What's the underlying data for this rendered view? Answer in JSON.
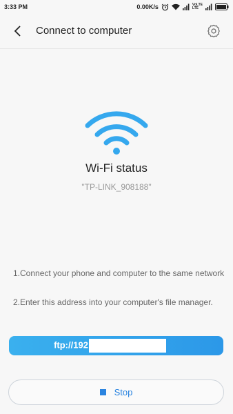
{
  "status_bar": {
    "time": "3:33 PM",
    "speed": "0.00K/s",
    "lte_top": "VoLTE",
    "lte_bottom": "LTE",
    "icons": [
      "alarm-icon",
      "wifi-icon",
      "signal-icon",
      "signal-icon",
      "battery-icon"
    ]
  },
  "header": {
    "title": "Connect to computer",
    "back_icon": "back-arrow-icon",
    "settings_icon": "gear-icon"
  },
  "wifi": {
    "status_label": "Wi-Fi status",
    "ssid": "\"TP-LINK_908188\"",
    "accent_color": "#35a8ee"
  },
  "instructions": {
    "step1": "1.Connect your phone and computer to the same network",
    "step2": "2.Enter this address into your computer's file manager."
  },
  "ftp": {
    "address_prefix": "ftp://192"
  },
  "actions": {
    "stop_label": "Stop",
    "stop_color": "#2b84e0"
  }
}
